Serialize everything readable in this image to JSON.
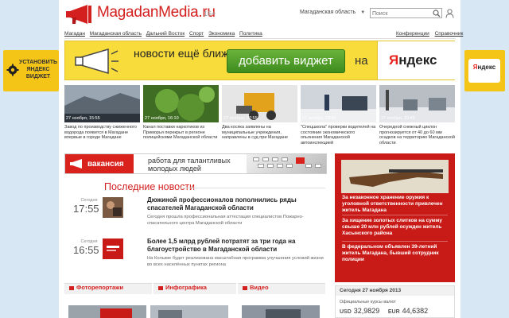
{
  "header": {
    "logo_text": "MagadanMedia.ru",
    "age_rating": "16+",
    "region": "Магаданская область",
    "search_placeholder": "Поиск"
  },
  "nav": {
    "left": [
      "Магадан",
      "Магаданская область",
      "Дальний Восток",
      "Спорт",
      "Экономика",
      "Политика"
    ],
    "right": [
      "Конференции",
      "Справочник"
    ]
  },
  "side_promo": {
    "left_text": "УСТАНОВИТЬ ЯНДЕКС ВИДЖЕТ",
    "right_logo_y": "Я",
    "right_logo_rest": "ндекс"
  },
  "banner": {
    "text": "новости ещё ближе, если",
    "button": "добавить виджет",
    "na": "на",
    "logo_y": "Я",
    "logo_rest": "ндекс"
  },
  "strip": [
    {
      "date": "27 ноября, 15:55",
      "caption": "Завод по производству сжиженного водорода появится в Магадане впервые в городе Магадане"
    },
    {
      "date": "27 ноября, 16:10",
      "caption": "Канал поставки наркотиков из Приморья перекрыт в регионе полицейскими Магаданской области"
    },
    {
      "date": "27 ноября, 07:55",
      "caption": "Два косяка заявлены на муниципальные учреждения, направлены в суд при Магадане"
    },
    {
      "date": "27 ноября, 13:45",
      "caption": "\"Спецшкола\" проверки водителей на состояние экономического опьянения Магаданской автоинспекцией"
    },
    {
      "date": "27 ноября, 15:45",
      "caption": "Очередной снежный циклон прогнозируется от 40 до 60 мм осадков на территорию Магаданской области"
    }
  ],
  "vacancy": {
    "label": "вакансия",
    "text": "работа для талантливых молодых людей"
  },
  "latest": {
    "heading": "Последние новости",
    "items": [
      {
        "day": "Сегодня",
        "time": "17:55",
        "title": "Дюжиной профессионалов пополнились ряды спасателей Магаданской области",
        "desc": "Сегодня прошла профессиональная аттестация специалистов Пожарно-спасательного центра Магаданской области"
      },
      {
        "day": "Сегодня",
        "time": "16:55",
        "title": "Более 1,5 млрд рублей потратят за три года на благоустройство в Магаданской области",
        "desc": "На Колыме будет реализована масштабная программа улучшения условий жизни во всех населённых пунктах региона"
      }
    ]
  },
  "redbox": {
    "items": [
      "За незаконное хранение оружия к уголовной ответственности привлечен житель Магадана",
      "За хищение золотых слитков на сумму свыше 20 млн рублей осужден житель Хасынского района",
      "В федеральном объявлен 39-летний житель Магадана, бывший сотрудник полиции"
    ]
  },
  "bottom": {
    "photo": "Фоторепортажи",
    "info": "Инфографика",
    "video": "Видео"
  },
  "rates": {
    "date": "Сегодня 27 ноября 2013",
    "label": "Официальные курсы валют",
    "usd_code": "USD",
    "usd": "32,9829",
    "eur_code": "EUR",
    "eur": "44,6382"
  },
  "colors": {
    "brand_red": "#d41f1f",
    "banner_yellow": "#f8dc3b",
    "button_green": "#4a9a28",
    "page_bg": "#d7e7f3"
  }
}
